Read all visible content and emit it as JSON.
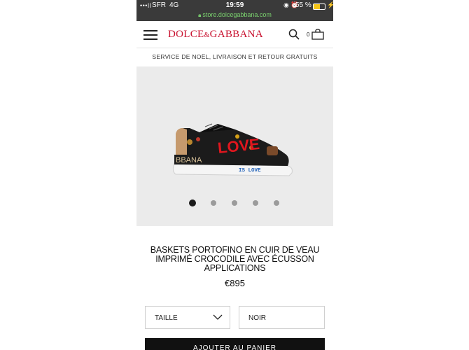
{
  "status_bar": {
    "signal": "•••ll",
    "carrier": "SFR",
    "network": "4G",
    "time": "19:59",
    "icons": "◉ ⏰",
    "battery_percent": "55 %",
    "url": "store.dolcegabbana.com"
  },
  "header": {
    "logo_left": "DOLCE",
    "logo_amp": "&",
    "logo_right": "GABBANA",
    "cart_count": "0"
  },
  "banner": {
    "text": "SERVICE DE NOËL, LIVRAISON ET RETOUR GRATUITS"
  },
  "product": {
    "image_text_love": "LOVE",
    "image_text_is_love": "IS LOVE",
    "image_text_heel": "BBANA",
    "carousel_count": 5,
    "carousel_active": 1,
    "title": "BASKETS PORTOFINO EN CUIR DE VEAU IMPRIMÉ CROCODILE AVEC ÉCUSSON APPLICATIONS",
    "price": "€895"
  },
  "options": {
    "size_label": "TAILLE",
    "color_value": "NOIR"
  },
  "cta": {
    "add_to_bag": "AJOUTER AU PANIER"
  },
  "colors": {
    "brand_red": "#c8102e",
    "status_bar": "#3a3a3a",
    "url_green": "#7bd46f"
  }
}
